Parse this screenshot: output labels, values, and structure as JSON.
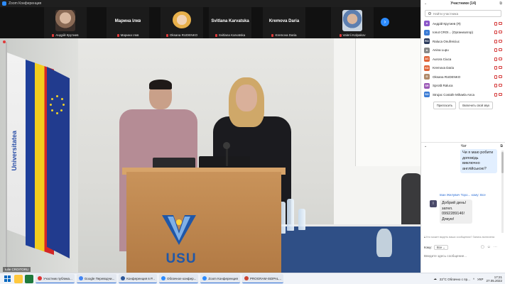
{
  "window": {
    "title": "Zoom Конференция"
  },
  "strip": {
    "tiles": [
      {
        "name": "Андрій Крутиев"
      },
      {
        "name": "Марина Ілкв",
        "center": "Марина Ілкв"
      },
      {
        "name": "Oksana RUDENKO"
      },
      {
        "name": "Svitlana Karvatska",
        "center": "Svitlana Karvatska"
      },
      {
        "name": "Kremova Daria",
        "center": "Kremova Daria"
      },
      {
        "name": "Valerii Kolpakov"
      }
    ]
  },
  "video": {
    "speaker_name": "Iulie CROITORU",
    "flag_text": "Universitatea",
    "podium_logo": "USU"
  },
  "participants": {
    "title": "Участники (14)",
    "search_placeholder": "Найти участника",
    "items": [
      {
        "initials": "A",
        "color": "#8a56c9",
        "name": "Андрій Крутиев (Я)"
      },
      {
        "initials": "I",
        "color": "#3a7bd5",
        "name": "Ionut CROI... (Организатор)"
      },
      {
        "initials": "RO",
        "color": "#2b3a5c",
        "name": "Raluca Onufreiciuc"
      },
      {
        "initials": "A",
        "color": "#888888",
        "name": "Anina Lupu"
      },
      {
        "initials": "AC",
        "color": "#e0653a",
        "name": "Aurora Ciuca"
      },
      {
        "initials": "KD",
        "color": "#e0653a",
        "name": "Kremova Daria"
      },
      {
        "initials": "O",
        "color": "#b08a6a",
        "name": "Oksana RUDENKO"
      },
      {
        "initials": "SR",
        "color": "#9b59b6",
        "name": "Sprotă Raluca"
      },
      {
        "initials": "SO",
        "color": "#3a7bd5",
        "name": "Strujac Costafe Mihaela Anca"
      }
    ],
    "invite_label": "Пригласить",
    "mute_label": "Включить свой звук"
  },
  "chat": {
    "title": "Чат",
    "outgoing": "Чи я маю робити доповідь виключно англійською?",
    "from": "Іван Желувич Торо...",
    "to_label": "кому: Все",
    "incoming_initial": "I",
    "incoming": "Добрий день! зател. 0992289146! Дякую!",
    "note": "Кто может видеть ваши сообщения? Запись включена",
    "recipient_label": "Кому:",
    "recipient_value": "Все",
    "input_placeholder": "Введите здесь сообщение..."
  },
  "taskbar": {
    "apps": [
      {
        "label": "Участник публика...",
        "color": "#d33"
      },
      {
        "label": "Google Переводчи...",
        "color": "#4285f4"
      },
      {
        "label": "Конференция в Р...",
        "color": "#2b579a"
      },
      {
        "label": "Облачное конфер...",
        "color": "#2d8cff"
      },
      {
        "label": "Zoom Конференция",
        "color": "#2d8cff"
      },
      {
        "label": "PROGRAM-ISDPAL...",
        "color": "#c43"
      }
    ],
    "weather": "22°C Облачно с пр...",
    "lang": "УКР",
    "time": "17:21",
    "date": "27.05.2022"
  }
}
